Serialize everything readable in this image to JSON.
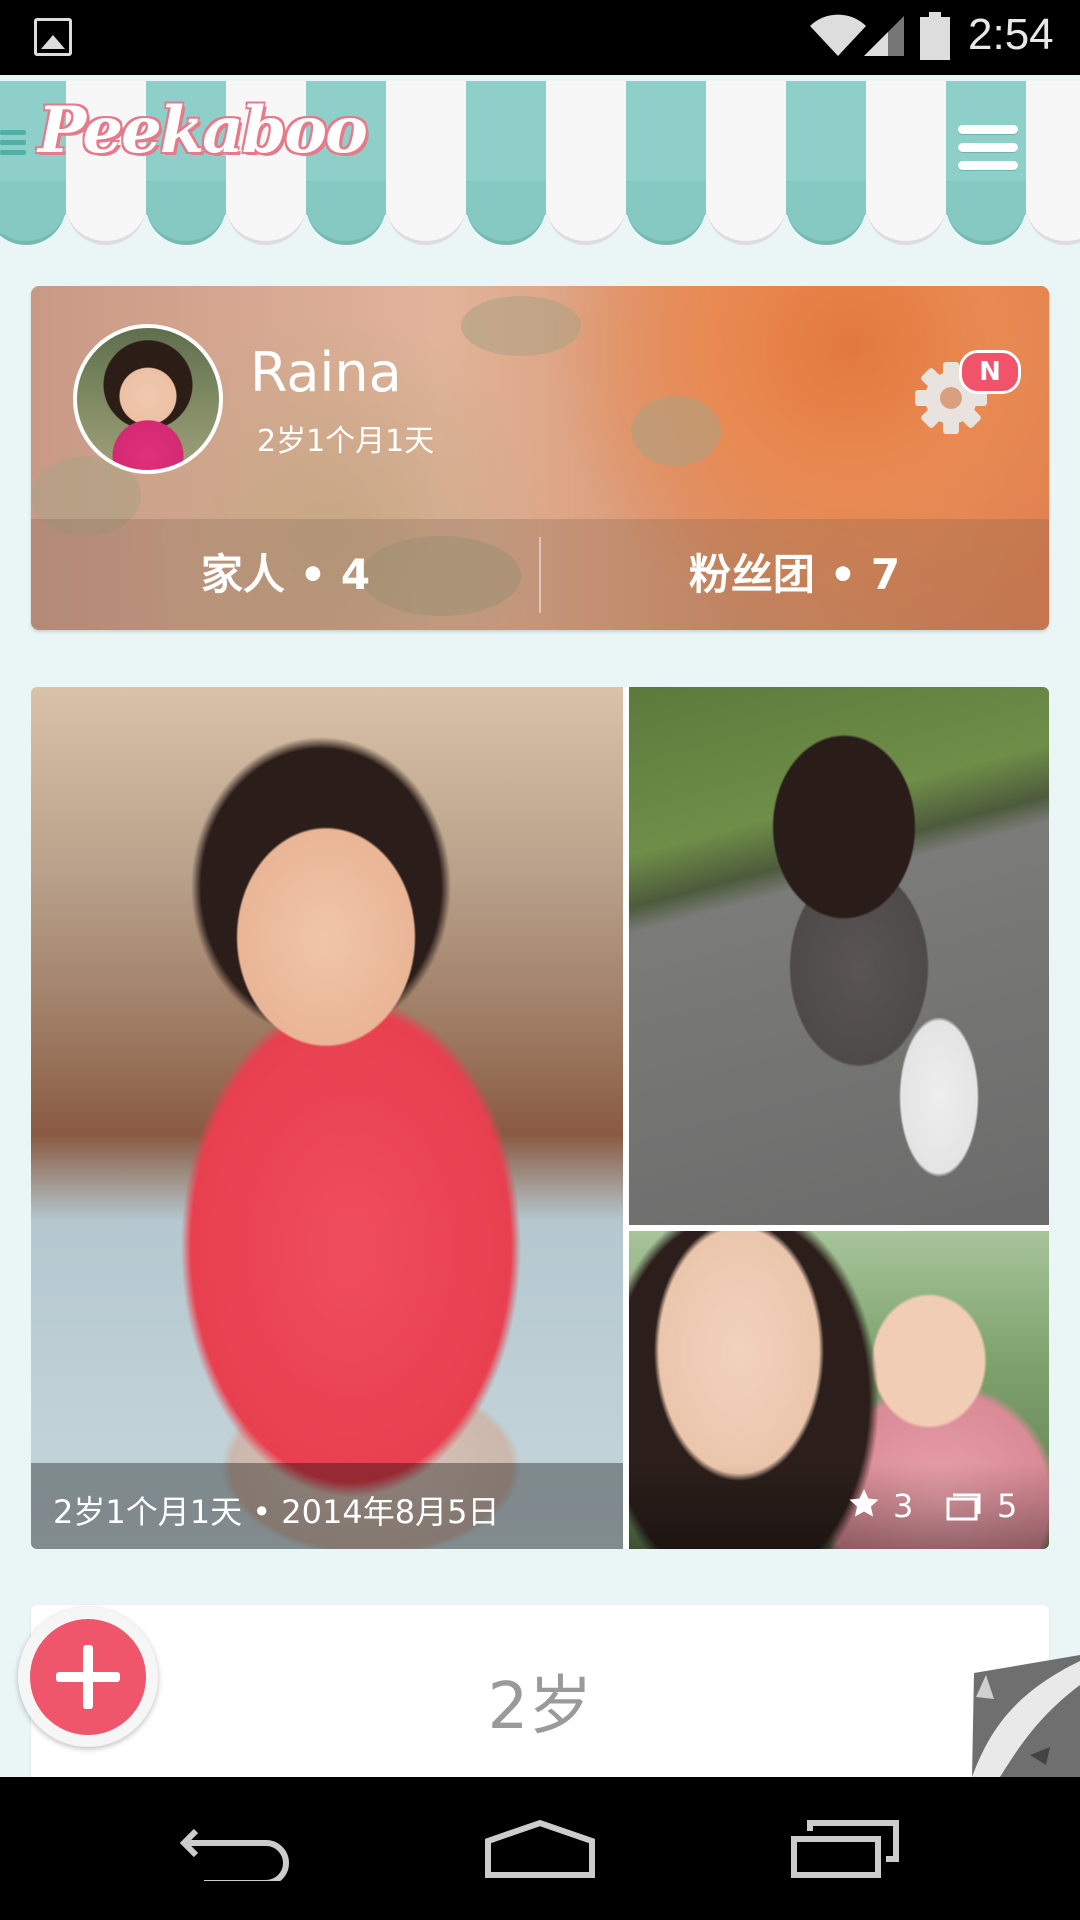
{
  "status_bar": {
    "time": "2:54",
    "icons": [
      "gallery-icon",
      "wifi-icon",
      "signal-icon",
      "battery-icon"
    ]
  },
  "header": {
    "logo_text": "Peekaboo",
    "menu_icon": "hamburger-menu-icon",
    "colors": {
      "awning_teal": "#8fcfc9",
      "awning_white": "#f7f7f7",
      "logo_pink": "#e67a8a"
    }
  },
  "profile": {
    "name": "Raina",
    "age": "2岁1个月1天",
    "settings_badge": "N",
    "family_label": "家人 • 4",
    "fans_label": "粉丝团 • 7"
  },
  "photo_card": {
    "caption": "2岁1个月1天 • 2014年8月5日",
    "star_count": "3",
    "photo_count": "5"
  },
  "timeline": {
    "age_section_label": "2岁"
  },
  "colors": {
    "background": "#eaf6f6",
    "accent_red": "#f0566b"
  }
}
